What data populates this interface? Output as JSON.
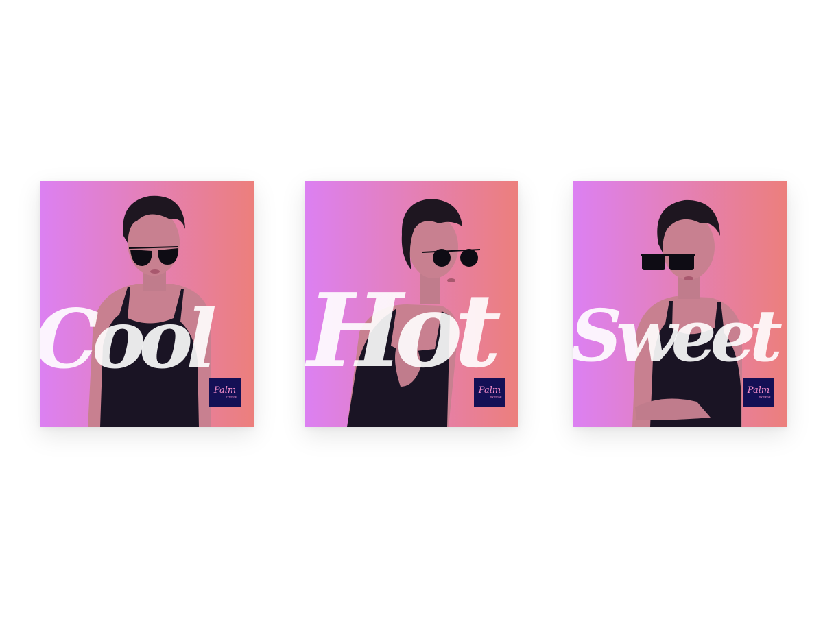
{
  "colors": {
    "gradient_start": "#dc80f2",
    "gradient_end": "#ec7f7c",
    "script_text": "#ffffff",
    "logo_bg": "#141055",
    "logo_text": "#f08cc8",
    "top_color": "#1a1424",
    "skin": "#c88090",
    "hair": "#1e1620",
    "lens": "#0e0c14"
  },
  "cards": [
    {
      "word": "Cool",
      "pose": "front-aviator"
    },
    {
      "word": "Hot",
      "pose": "side-round"
    },
    {
      "word": "Sweet",
      "pose": "front-square"
    }
  ],
  "logo": {
    "wordmark": "Palm",
    "sub": "eyewear"
  }
}
